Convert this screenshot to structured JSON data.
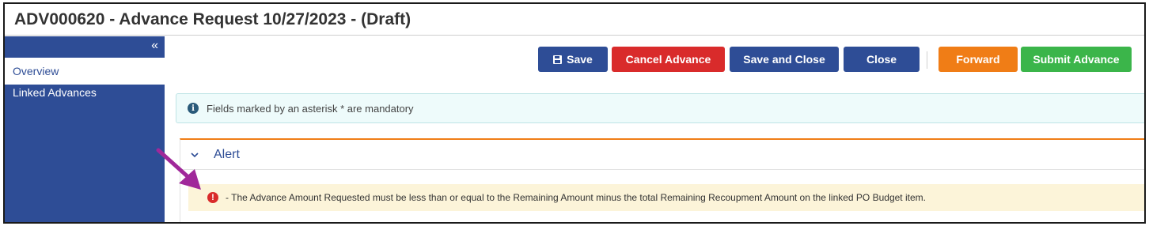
{
  "window": {
    "title": "ADV000620 - Advance Request 10/27/2023 - (Draft)"
  },
  "sidebar": {
    "collapse_icon": "double-chevron-left-icon",
    "items": [
      {
        "label": "Overview",
        "active": true
      },
      {
        "label": "Linked Advances",
        "active": false
      }
    ]
  },
  "toolbar": {
    "save_label": "Save",
    "cancel_label": "Cancel Advance",
    "save_close_label": "Save and Close",
    "close_label": "Close",
    "forward_label": "Forward",
    "submit_label": "Submit Advance"
  },
  "info": {
    "icon": "info-icon",
    "text": "Fields marked by an asterisk * are mandatory"
  },
  "alert": {
    "title": "Alert",
    "icon": "error-icon",
    "message": "- The Advance Amount Requested must be less than or equal to the Remaining Amount minus the total Remaining Recoupment Amount on the linked PO Budget item."
  },
  "colors": {
    "primary": "#2e4d96",
    "danger": "#d92b2b",
    "warning": "#f07d16",
    "success": "#3bb54a",
    "annotation_arrow": "#a0289a"
  }
}
